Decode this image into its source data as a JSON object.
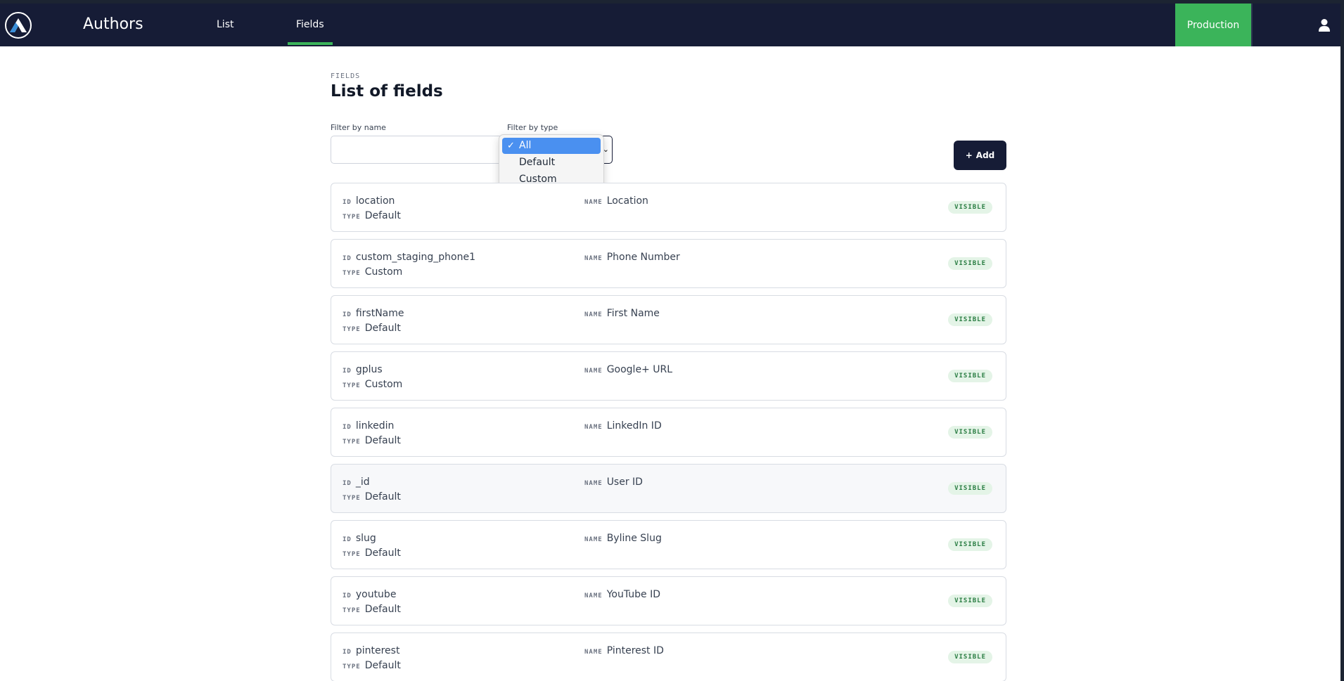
{
  "header": {
    "app_title": "Authors",
    "logo_icon": "triangle-a-logo",
    "tabs": [
      {
        "label": "List",
        "active": false
      },
      {
        "label": "Fields",
        "active": true
      }
    ],
    "environment_label": "Production",
    "user_icon": "user-icon",
    "accent_color": "#3bb45a",
    "nav_bg_color": "#161c36"
  },
  "page": {
    "eyebrow": "FIELDS",
    "title": "List of fields"
  },
  "filters": {
    "name_label": "Filter by name",
    "name_value": "",
    "type_label": "Filter by type",
    "type_selected": "All",
    "type_options": [
      "All",
      "Default",
      "Custom"
    ]
  },
  "add_button": {
    "icon": "plus-icon",
    "label": "Add"
  },
  "keys": {
    "id": "ID",
    "type": "TYPE",
    "name": "NAME"
  },
  "fields": [
    {
      "id": "location",
      "type": "Default",
      "name": "Location",
      "status": "VISIBLE"
    },
    {
      "id": "custom_staging_phone1",
      "type": "Custom",
      "name": "Phone Number",
      "status": "VISIBLE"
    },
    {
      "id": "firstName",
      "type": "Default",
      "name": "First Name",
      "status": "VISIBLE"
    },
    {
      "id": "gplus",
      "type": "Custom",
      "name": "Google+ URL",
      "status": "VISIBLE"
    },
    {
      "id": "linkedin",
      "type": "Default",
      "name": "LinkedIn ID",
      "status": "VISIBLE"
    },
    {
      "id": "_id",
      "type": "Default",
      "name": "User ID",
      "status": "VISIBLE"
    },
    {
      "id": "slug",
      "type": "Default",
      "name": "Byline Slug",
      "status": "VISIBLE"
    },
    {
      "id": "youtube",
      "type": "Default",
      "name": "YouTube ID",
      "status": "VISIBLE"
    },
    {
      "id": "pinterest",
      "type": "Default",
      "name": "Pinterest ID",
      "status": "VISIBLE"
    }
  ]
}
